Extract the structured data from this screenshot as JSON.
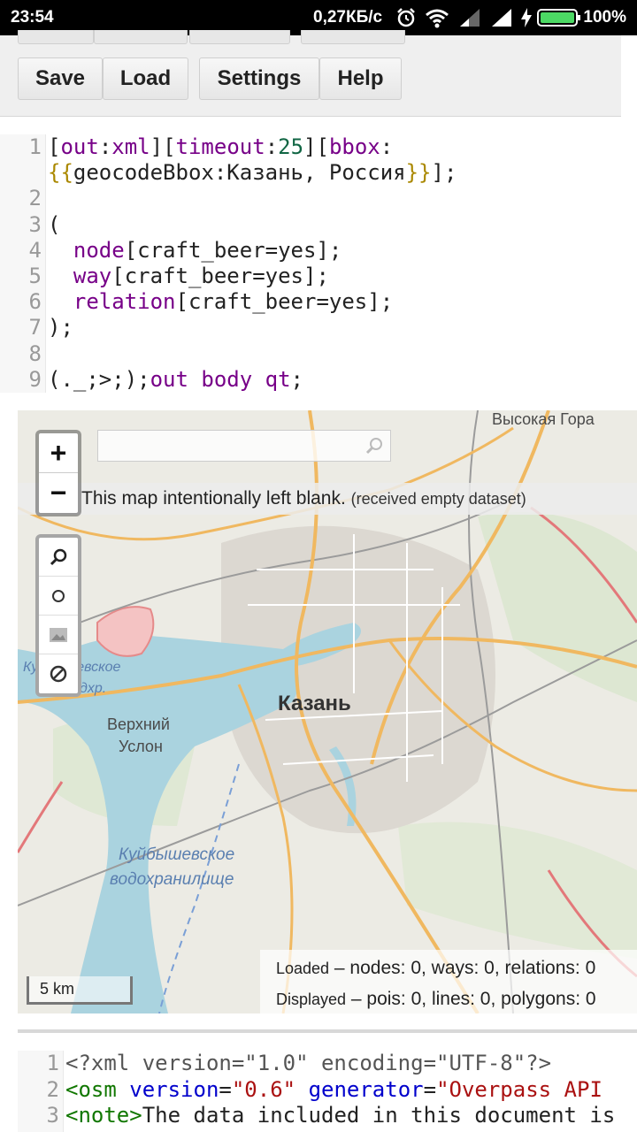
{
  "status_bar": {
    "time": "23:54",
    "net_speed": "0,27КБ/с",
    "battery_percent": "100%",
    "icons": [
      "alarm-icon",
      "wifi-icon",
      "signal-icon",
      "signal-icon",
      "charging-icon",
      "battery-icon"
    ]
  },
  "toolbar": {
    "save_label": "Save",
    "load_label": "Load",
    "settings_label": "Settings",
    "help_label": "Help"
  },
  "query_editor": {
    "line_numbers": [
      "1",
      "2",
      "3",
      "4",
      "5",
      "6",
      "7",
      "8",
      "9"
    ],
    "lines": [
      {
        "segments": [
          [
            "p",
            "["
          ],
          [
            "kw",
            "out"
          ],
          [
            "p",
            ":"
          ],
          [
            "kw",
            "xml"
          ],
          [
            "p",
            "]["
          ],
          [
            "kw",
            "timeout"
          ],
          [
            "p",
            ":"
          ],
          [
            "num",
            "25"
          ],
          [
            "p",
            "]["
          ],
          [
            "kw",
            "bbox"
          ],
          [
            "p",
            ":"
          ]
        ]
      },
      {
        "segments": [
          [
            "brace",
            "{{"
          ],
          [
            "p",
            "geocodeBbox:Казань, Россия"
          ],
          [
            "brace",
            "}}"
          ],
          [
            "p",
            "];"
          ]
        ]
      },
      {
        "segments": []
      },
      {
        "segments": [
          [
            "p",
            "("
          ]
        ]
      },
      {
        "segments": [
          [
            "p",
            "  "
          ],
          [
            "kw",
            "node"
          ],
          [
            "p",
            "[craft_beer=yes];"
          ]
        ]
      },
      {
        "segments": [
          [
            "p",
            "  "
          ],
          [
            "kw",
            "way"
          ],
          [
            "p",
            "[craft_beer=yes];"
          ]
        ]
      },
      {
        "segments": [
          [
            "p",
            "  "
          ],
          [
            "kw",
            "relation"
          ],
          [
            "p",
            "[craft_beer=yes];"
          ]
        ]
      },
      {
        "segments": [
          [
            "p",
            ");"
          ]
        ]
      },
      {
        "segments": []
      },
      {
        "segments": [
          [
            "p",
            "(._;>;);"
          ],
          [
            "kw",
            "out body qt"
          ],
          [
            "p",
            ";"
          ]
        ]
      }
    ]
  },
  "map": {
    "search_placeholder": "",
    "blank_message": "This map intentionally left blank.",
    "blank_detail": "(received empty dataset)",
    "labels": {
      "vysokaya_gora": "Высокая Гора",
      "kazan": "Казань",
      "verkhny_uslon_1": "Верхний",
      "verkhny_uslon_2": "Услон",
      "reservoir_1": "Куйбышевское",
      "reservoir_2": "водохранилище",
      "reservoir_small_1": "Куйбышевское",
      "reservoir_small_2": "вдхр."
    },
    "stats": {
      "loaded_label": "Loaded",
      "loaded_values": "– nodes: 0, ways: 0, relations: 0",
      "displayed_label": "Displayed",
      "displayed_values": "– pois: 0, lines: 0, polygons: 0"
    },
    "scale_label": "5 km",
    "zoom_in": "+",
    "zoom_out": "−",
    "colors": {
      "water": "#aad3df",
      "land": "#ecebe4",
      "major_road": "#f0b860",
      "urban": "#d9d6cf",
      "park": "#cde6c0"
    }
  },
  "output_editor": {
    "line_numbers": [
      "1",
      "2",
      "3"
    ],
    "lines": [
      {
        "segments": [
          [
            "meta",
            "<?xml version=\"1.0\" encoding=\"UTF-8\"?>"
          ]
        ]
      },
      {
        "segments": [
          [
            "tag",
            "<osm "
          ],
          [
            "attr",
            "version"
          ],
          [
            "p",
            "="
          ],
          [
            "str",
            "\"0.6\""
          ],
          [
            "p",
            " "
          ],
          [
            "attr",
            "generator"
          ],
          [
            "p",
            "="
          ],
          [
            "str",
            "\"Overpass API"
          ]
        ]
      },
      {
        "segments": [
          [
            "tag",
            "<note>"
          ],
          [
            "p",
            "The data included in this document is"
          ]
        ]
      }
    ]
  }
}
